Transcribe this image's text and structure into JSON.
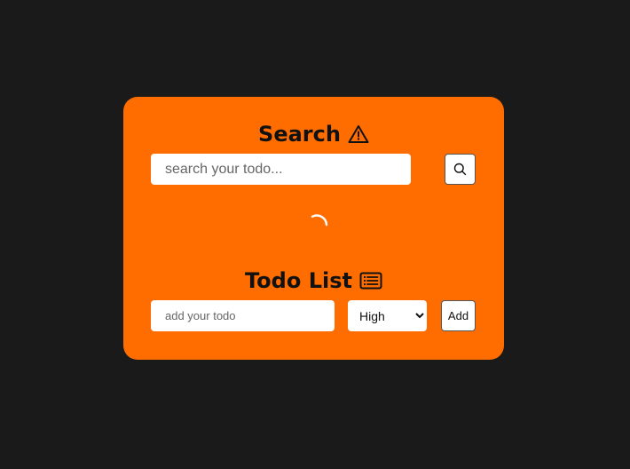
{
  "search": {
    "title": "Search",
    "title_icon": "warning-icon",
    "placeholder": "search your todo...",
    "value": "",
    "button_icon": "search-icon"
  },
  "loading": {
    "icon": "spinner-icon"
  },
  "todo": {
    "title": "Todo List",
    "title_icon": "list-icon",
    "placeholder": "add your todo",
    "value": "",
    "priority_selected": "High",
    "priority_options": [
      "High"
    ],
    "add_label": "Add"
  },
  "colors": {
    "background": "#1a1a1a",
    "card": "#ff6d00",
    "heading": "#111111"
  }
}
